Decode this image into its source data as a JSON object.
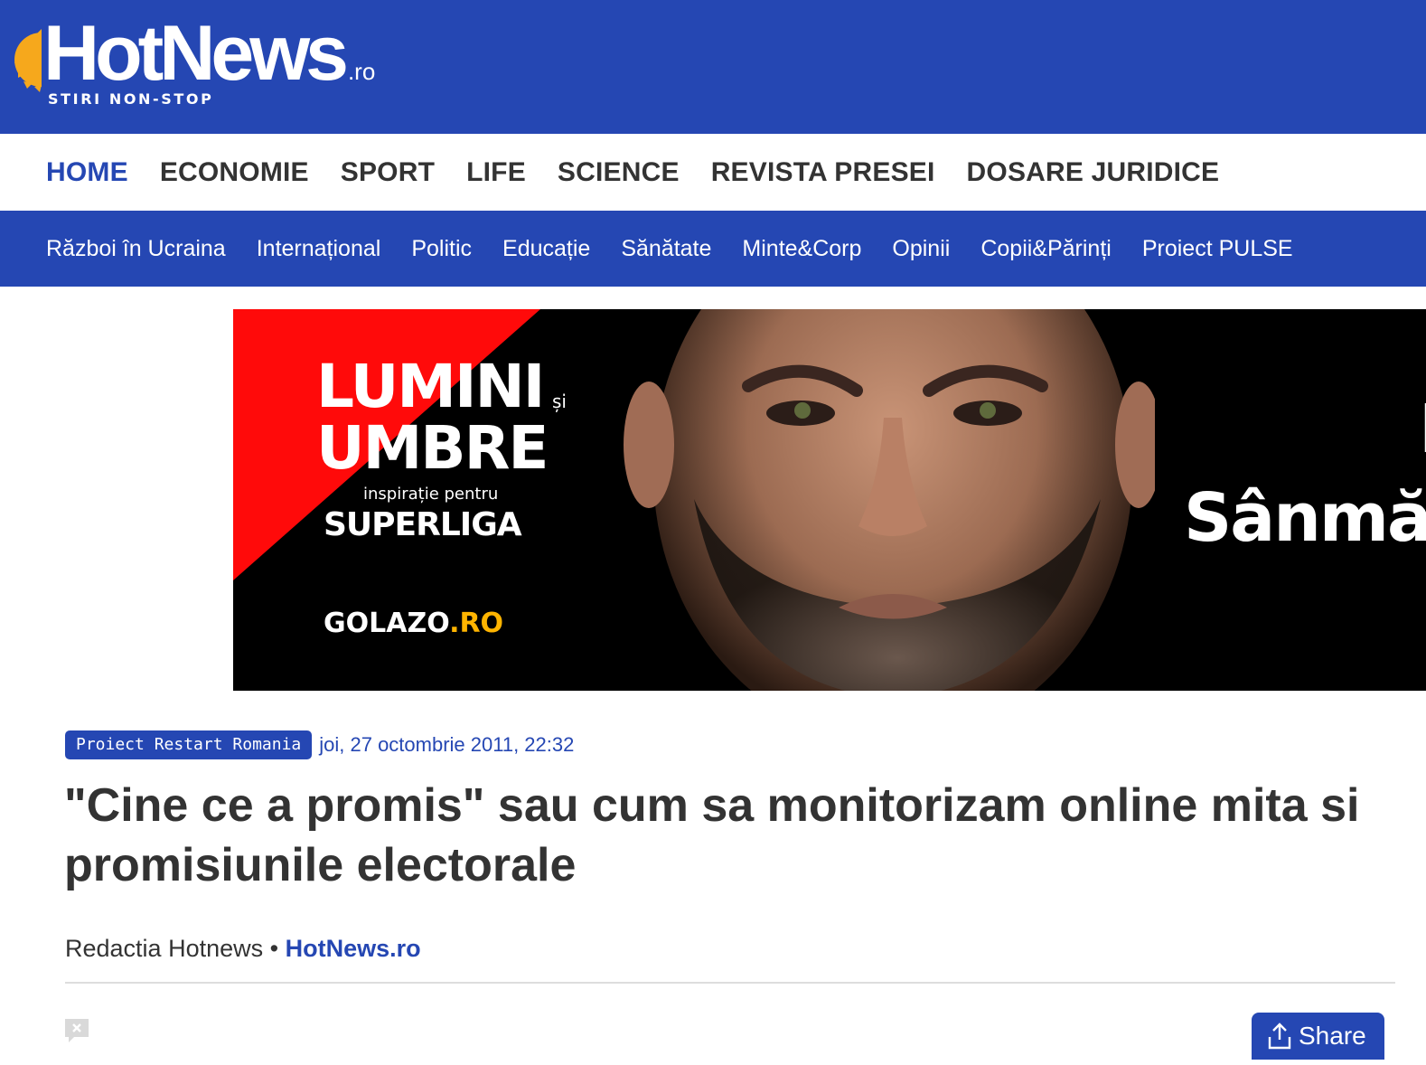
{
  "header": {
    "logo_text": "HotNews",
    "logo_suffix": ".ro",
    "logo_tagline": "STIRI NON-STOP",
    "brand_color": "#2547b3"
  },
  "main_nav": {
    "items": [
      {
        "label": "HOME",
        "active": true
      },
      {
        "label": "ECONOMIE"
      },
      {
        "label": "SPORT"
      },
      {
        "label": "LIFE"
      },
      {
        "label": "SCIENCE"
      },
      {
        "label": "REVISTA PRESEI"
      },
      {
        "label": "DOSARE JURIDICE"
      }
    ]
  },
  "sub_nav": {
    "items": [
      {
        "label": "Război în Ucraina"
      },
      {
        "label": "Internațional"
      },
      {
        "label": "Politic"
      },
      {
        "label": "Educație"
      },
      {
        "label": "Sănătate"
      },
      {
        "label": "Minte&Corp"
      },
      {
        "label": "Opinii"
      },
      {
        "label": "Copii&Părinți"
      },
      {
        "label": "Proiect PULSE"
      }
    ]
  },
  "banner": {
    "title_line1": "LUMINI",
    "title_connector": "și",
    "title_line2": "UMBRE",
    "subtitle": "inspirație pentru",
    "league": "SUPERLIGA",
    "brand_main": "GOLAZO",
    "brand_suffix": ".RO",
    "name_partial": "Sânmă",
    "letter_partial": "L"
  },
  "article": {
    "category": "Proiect Restart Romania",
    "date": "joi, 27 octombrie 2011, 22:32",
    "title": "\"Cine ce a promis\" sau cum sa monitorizam online mita si promisiunile electorale",
    "author": "Redactia Hotnews",
    "separator": "•",
    "source": "HotNews.ro"
  },
  "actions": {
    "share_label": "Share",
    "share_icon": "share-upload-icon",
    "comment_icon": "comment-icon"
  }
}
